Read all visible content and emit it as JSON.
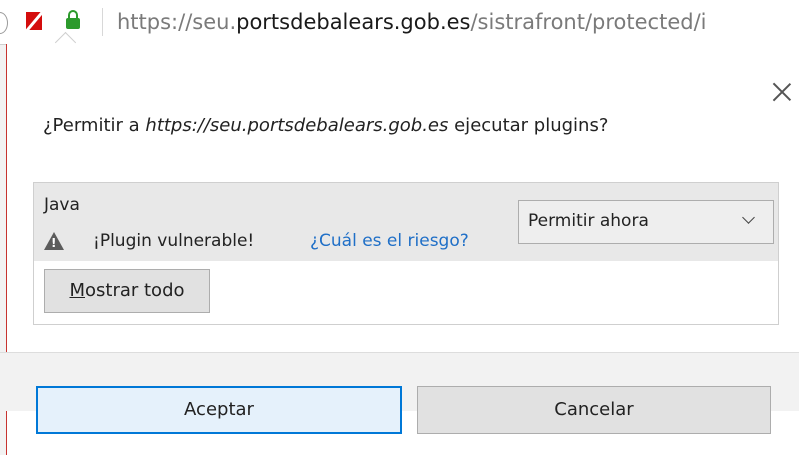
{
  "urlbar": {
    "url_prefix": "https://seu.",
    "url_host": "portsdebalears.gob.es",
    "url_path": "/sistrafront/protected/i",
    "icons": [
      "blocked-plugin-icon",
      "lock-icon"
    ]
  },
  "dialog": {
    "question_prefix": "¿Permitir a ",
    "question_site": "https://seu.portsdebalears.gob.es",
    "question_suffix": " ejecutar plugins?",
    "plugin": {
      "name": "Java",
      "warning": "¡Plugin vulnerable!",
      "risk_link": "¿Cuál es el riesgo?",
      "permission_selected": "Permitir ahora"
    },
    "show_all_mnemonic": "M",
    "show_all_rest": "ostrar todo",
    "accept_label": "Aceptar",
    "cancel_label": "Cancelar"
  },
  "colors": {
    "accent": "#0078d7",
    "link": "#1f6fc7",
    "blocked_red": "#d40d0d",
    "lock_green": "#2c9a2c"
  }
}
